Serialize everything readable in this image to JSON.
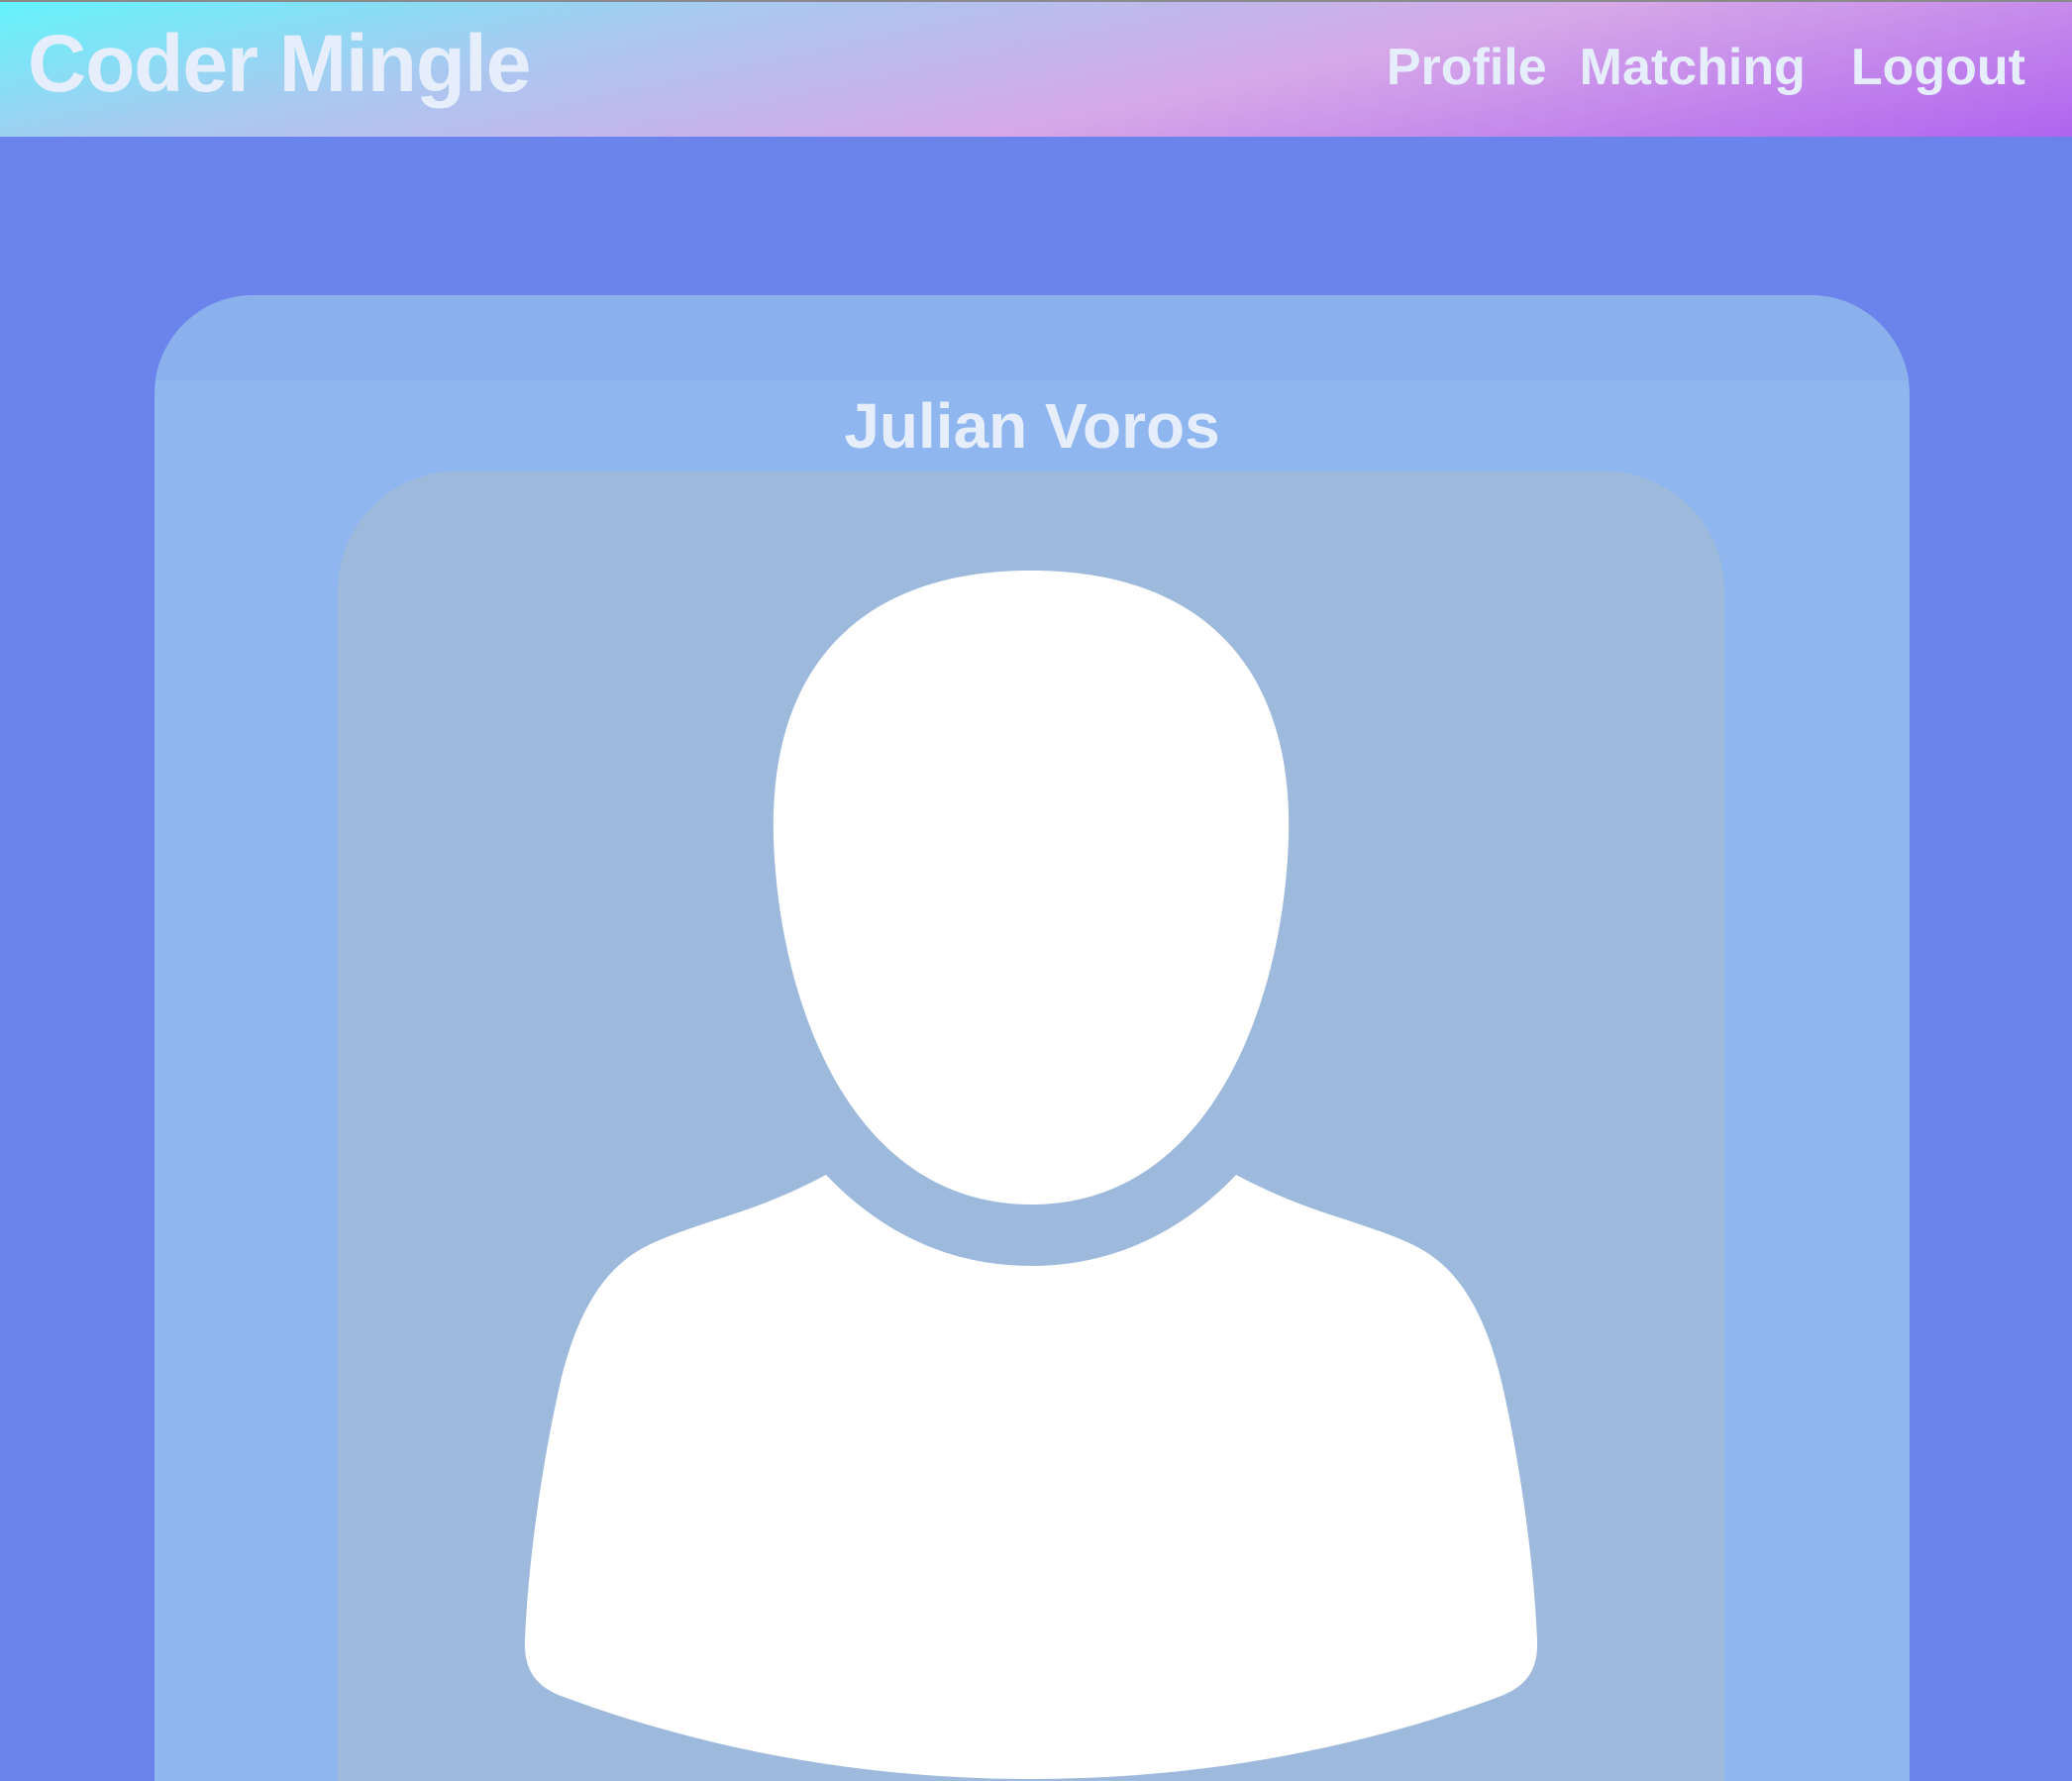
{
  "app": {
    "brand": "Coder Mingle"
  },
  "nav": {
    "profile": "Profile",
    "matching": "Matching",
    "logout": "Logout"
  },
  "profile_card": {
    "name": "Julian Voros",
    "avatar_icon": "user-silhouette-icon"
  },
  "colors": {
    "page_background": "#6b84eb",
    "card_background": "#8fb6ef",
    "photo_background": "#9dbadd",
    "text": "#e6eefb",
    "navbar_gradient_start": "#64f4fb",
    "navbar_gradient_end": "#b064ef"
  }
}
